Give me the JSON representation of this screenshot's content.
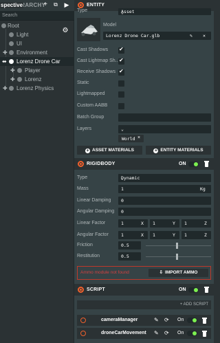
{
  "hierarchy": {
    "perspective_label": "spective",
    "title": "HIERARCHY",
    "search_placeholder": "Search",
    "items": [
      {
        "label": "Root"
      },
      {
        "label": "Light"
      },
      {
        "label": "UI"
      },
      {
        "label": "Environment"
      },
      {
        "label": "Lorenz Drone Car"
      },
      {
        "label": "Player"
      },
      {
        "label": "Lorenz"
      },
      {
        "label": "Lorenz Physics"
      }
    ]
  },
  "entity": {
    "title": "ENTITY",
    "type_label": "Type",
    "type_value": "Asset",
    "model_label": "Model",
    "model_value": "Lorenz Drone Car.glb",
    "checks": [
      {
        "label": "Cast Shadows",
        "checked": true
      },
      {
        "label": "Cast Lightmap Sh...",
        "checked": true
      },
      {
        "label": "Receive Shadows",
        "checked": true
      },
      {
        "label": "Static",
        "checked": false
      },
      {
        "label": "Lightmapped",
        "checked": false
      },
      {
        "label": "Custom AABB",
        "checked": false
      }
    ],
    "batch_group_label": "Batch Group",
    "layers_label": "Layers",
    "layer_tag": "World",
    "layer_tag_close": "×",
    "asset_materials_btn": "ASSET MATERIALS",
    "entity_materials_btn": "ENTITY MATERIALS"
  },
  "rigidbody": {
    "title": "RIGIDBODY",
    "on_label": "ON",
    "type_label": "Type",
    "type_value": "Dynamic",
    "mass_label": "Mass",
    "mass_value": "1",
    "mass_unit": "Kg",
    "linear_damping_label": "Linear Damping",
    "linear_damping_value": "0",
    "angular_damping_label": "Angular Damping",
    "angular_damping_value": "0",
    "linear_factor_label": "Linear Factor",
    "linear_factor": [
      "1",
      "1",
      "1"
    ],
    "angular_factor_label": "Angular Factor",
    "angular_factor": [
      "1",
      "1",
      "1"
    ],
    "axis_x": "X",
    "axis_y": "Y",
    "axis_z": "Z",
    "friction_label": "Friction",
    "friction_value": "0.5",
    "friction_slider": 0.5,
    "restitution_label": "Restitution",
    "restitution_value": "0.5",
    "restitution_slider": 0.5,
    "error_text": "Ammo module not found",
    "import_ammo_btn": "IMPORT AMMO"
  },
  "script": {
    "title": "SCRIPT",
    "on_label": "ON",
    "add_script_btn": "+ ADD SCRIPT",
    "scripts": [
      {
        "name": "cameraManager",
        "on": "On"
      },
      {
        "name": "droneCarMovement",
        "on": "On"
      }
    ]
  },
  "colors": {
    "accent": "#f0602c",
    "toggle_on": "#7cf050",
    "error": "#d34141"
  }
}
